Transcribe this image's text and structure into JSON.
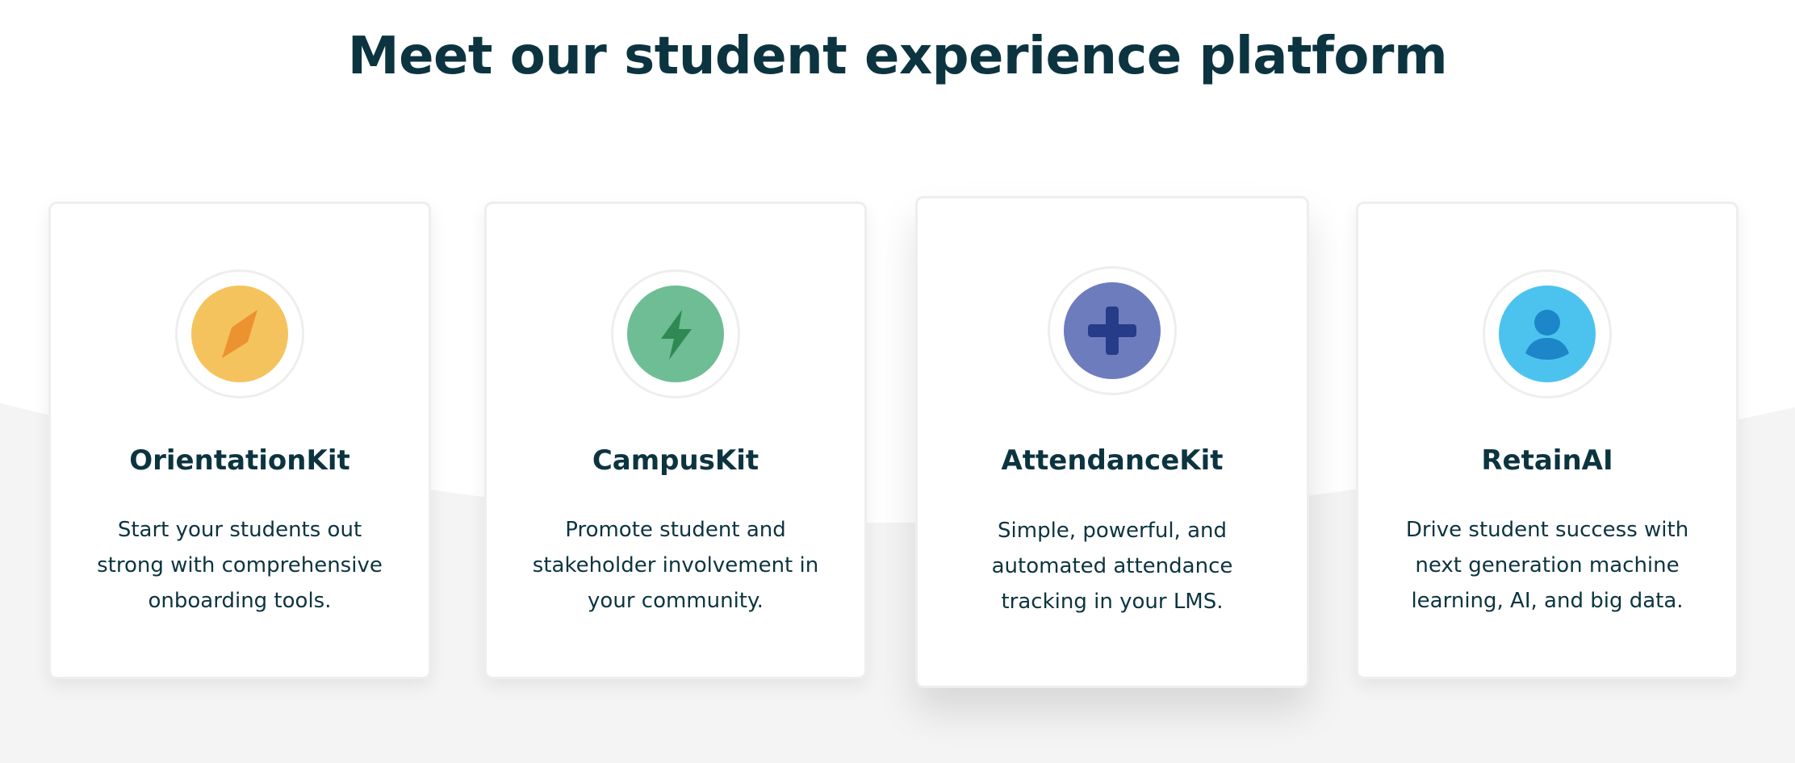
{
  "heading": "Meet our student experience platform",
  "colors": {
    "heading_text": "#0c3440",
    "background_band": "#f4f4f4"
  },
  "cards": [
    {
      "title": "OrientationKit",
      "description": "Start your students out strong with comprehensive onboarding tools.",
      "icon": "compass-icon",
      "icon_bg": "#f5c35d",
      "icon_fg": "#ed9230"
    },
    {
      "title": "CampusKit",
      "description": "Promote student and stakeholder involvement in your community.",
      "icon": "lightning-bolt-icon",
      "icon_bg": "#6fbd95",
      "icon_fg": "#2e8a52"
    },
    {
      "title": "AttendanceKit",
      "description": "Simple, powerful, and automated attendance tracking in your LMS.",
      "icon": "plus-icon",
      "icon_bg": "#6d7cbd",
      "icon_fg": "#263c88"
    },
    {
      "title": "RetainAI",
      "description": "Drive student success with next generation machine learning, AI, and big data.",
      "icon": "user-icon",
      "icon_bg": "#4cc3ef",
      "icon_fg": "#1d86c8"
    }
  ]
}
